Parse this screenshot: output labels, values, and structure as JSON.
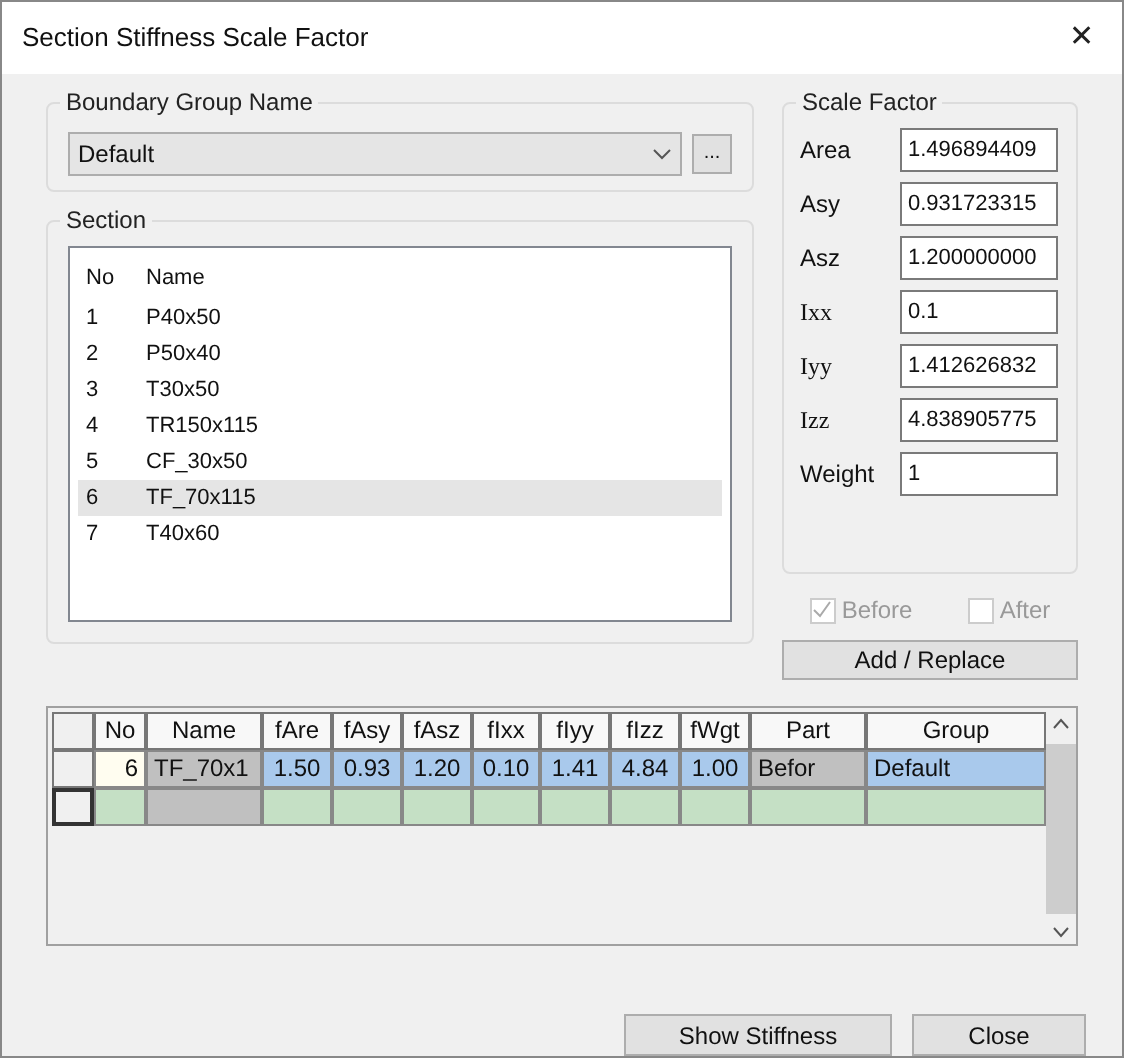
{
  "window": {
    "title": "Section Stiffness Scale Factor",
    "close": "✕"
  },
  "boundary_group": {
    "label": "Boundary Group Name",
    "value": "Default",
    "browse": "..."
  },
  "section": {
    "label": "Section",
    "columns": [
      "No",
      "Name"
    ],
    "rows": [
      {
        "no": "1",
        "name": "P40x50",
        "selected": false
      },
      {
        "no": "2",
        "name": "P50x40",
        "selected": false
      },
      {
        "no": "3",
        "name": "T30x50",
        "selected": false
      },
      {
        "no": "4",
        "name": "TR150x115",
        "selected": false
      },
      {
        "no": "5",
        "name": "CF_30x50",
        "selected": false
      },
      {
        "no": "6",
        "name": "TF_70x115",
        "selected": true
      },
      {
        "no": "7",
        "name": "T40x60",
        "selected": false
      }
    ]
  },
  "scale_factor": {
    "label": "Scale Factor",
    "fields": [
      {
        "label": "Area",
        "value": "1.496894409"
      },
      {
        "label": "Asy",
        "value": "0.931723315"
      },
      {
        "label": "Asz",
        "value": "1.200000000"
      },
      {
        "label": "Ixx",
        "value": "0.1"
      },
      {
        "label": "Iyy",
        "value": "1.412626832"
      },
      {
        "label": "Izz",
        "value": "4.838905775"
      },
      {
        "label": "Weight",
        "value": "1"
      }
    ]
  },
  "options": [
    {
      "label": "Before",
      "checked": true,
      "disabled": true
    },
    {
      "label": "After",
      "checked": false,
      "disabled": true
    }
  ],
  "add_button": "Add / Replace",
  "grid": {
    "columns": [
      "No",
      "Name",
      "fAre",
      "fAsy",
      "fAsz",
      "fIxx",
      "fIyy",
      "fIzz",
      "fWgt",
      "Part",
      "Group"
    ],
    "rows": [
      {
        "cells": [
          "6",
          "TF_70x1",
          "1.50",
          "0.93",
          "1.20",
          "0.10",
          "1.41",
          "4.84",
          "1.00",
          "Befor",
          "Default"
        ]
      }
    ]
  },
  "buttons": [
    "Show Stiffness",
    "Close"
  ]
}
